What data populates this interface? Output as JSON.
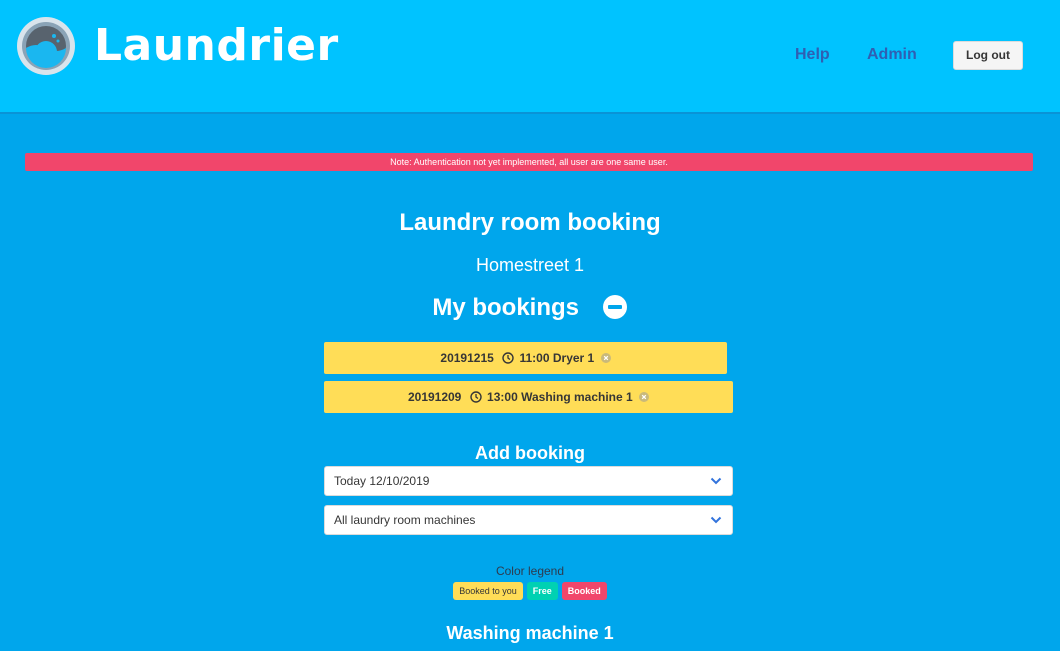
{
  "header": {
    "app_name": "Laundrier",
    "nav": {
      "help": "Help",
      "admin": "Admin"
    },
    "logout_label": "Log out",
    "colors": {
      "bar": "#00c3ff",
      "nav_link": "#2f5fb3"
    },
    "logo_icon": "washing-machine-icon"
  },
  "notice": {
    "text": "Note: Authentication not yet implemented, all user are one same user."
  },
  "main": {
    "title": "Laundry room booking",
    "address": "Homestreet 1",
    "my_bookings": {
      "heading": "My bookings",
      "toggle_icon": "minus-circle-icon",
      "items": [
        {
          "date": "20191215",
          "time": "11:00",
          "machine": "Dryer 1"
        },
        {
          "date": "20191209",
          "time": "13:00",
          "machine": "Washing machine 1"
        }
      ]
    },
    "add_booking": {
      "heading": "Add booking",
      "date_select": "Today 12/10/2019",
      "machine_select": "All laundry room machines"
    },
    "legend": {
      "title": "Color legend",
      "booked_to_you": "Booked to you",
      "free": "Free",
      "booked": "Booked",
      "colors": {
        "booked_to_you": "#ffdd57",
        "free": "#00d1b2",
        "booked": "#f1466b"
      }
    },
    "machine_section": {
      "title": "Washing machine 1"
    }
  },
  "colors": {
    "background": "#00a6ec",
    "notice": "#f1466b"
  }
}
